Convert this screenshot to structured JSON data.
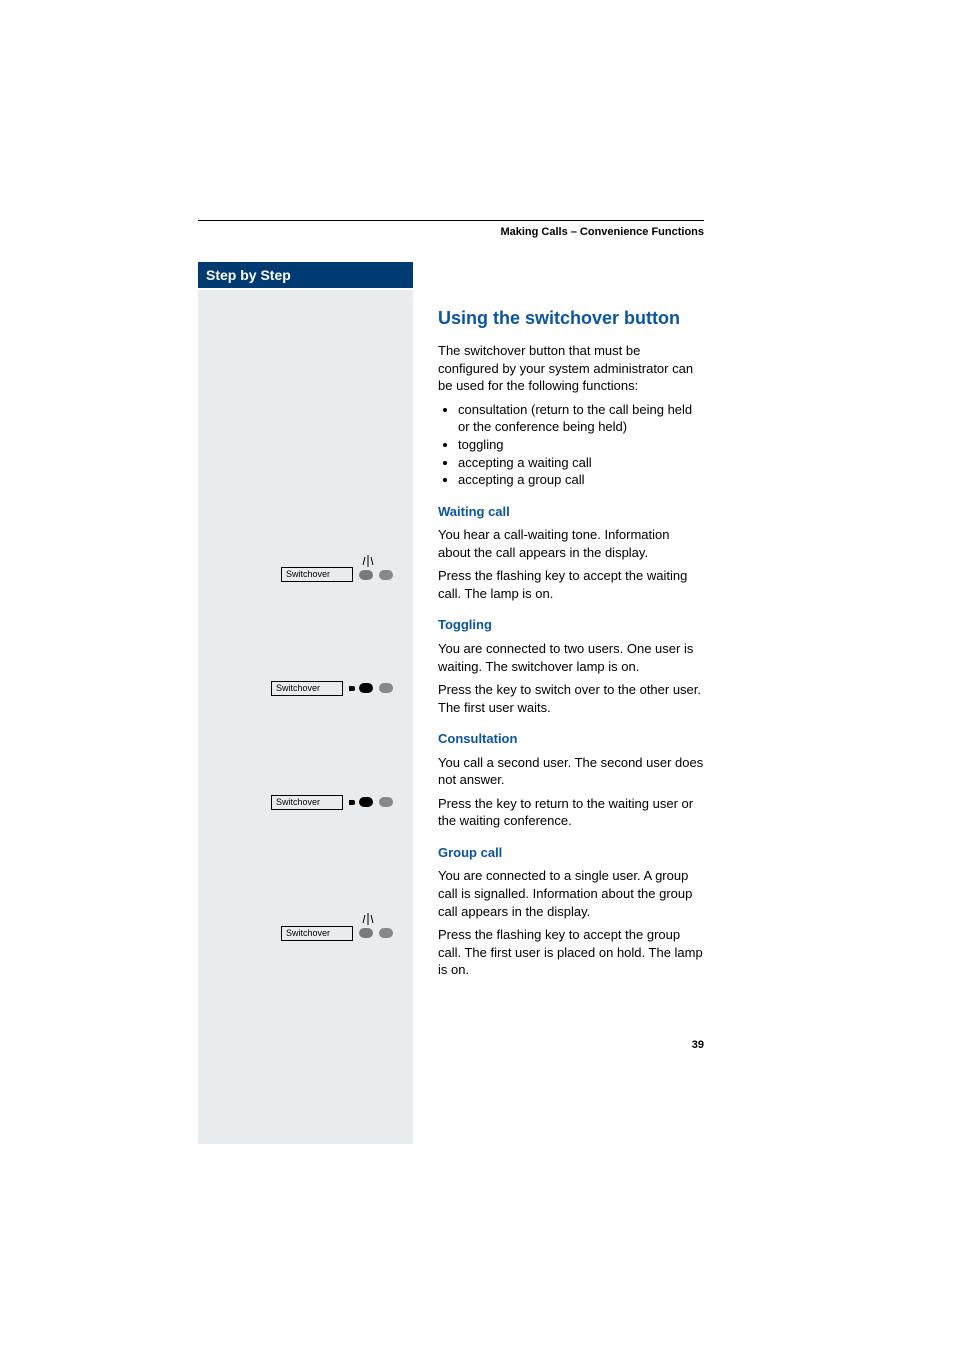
{
  "header": {
    "breadcrumb": "Making Calls – Convenience Functions"
  },
  "sidebar": {
    "title": "Step by Step",
    "keys": {
      "waiting": "Switchover",
      "toggling": "Switchover",
      "consultation": "Switchover",
      "group": "Switchover"
    }
  },
  "section": {
    "title": "Using the switchover button",
    "intro": "The switchover button that must be configured by your system administrator can be used for the following functions:",
    "bullets": [
      "consultation (return to the call being held or the conference being held)",
      "toggling",
      "accepting a waiting call",
      "accepting a group call"
    ],
    "waiting": {
      "heading": "Waiting call",
      "p1": "You hear a call-waiting tone. Information about the call appears in the display.",
      "p2": "Press the flashing key to accept the waiting call. The lamp is on."
    },
    "toggling": {
      "heading": "Toggling",
      "p1": "You are connected to two users. One user is waiting. The switchover lamp is on.",
      "p2": "Press the key to switch over to the other user. The first user waits."
    },
    "consultation": {
      "heading": "Consultation",
      "p1": "You call a second user. The second user does not answer.",
      "p2": "Press the key to return to the waiting user or the waiting conference."
    },
    "group": {
      "heading": "Group call",
      "p1": "You are connected to a single user. A group call is signalled. Information about the group call appears in the display.",
      "p2": "Press the flashing key to accept the group call. The first user is placed on hold. The lamp is on."
    }
  },
  "page_number": "39"
}
